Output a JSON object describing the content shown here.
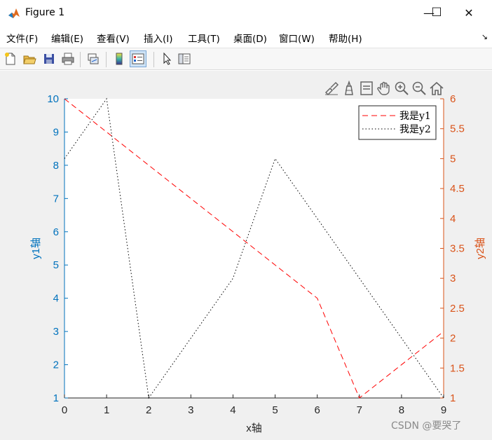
{
  "window": {
    "title": "Figure 1"
  },
  "window_controls": {
    "minimize": "—",
    "maximize": "☐",
    "close": "✕"
  },
  "menu": {
    "items": [
      "文件(F)",
      "编辑(E)",
      "查看(V)",
      "插入(I)",
      "工具(T)",
      "桌面(D)",
      "窗口(W)",
      "帮助(H)"
    ],
    "overflow_arrow": "↘"
  },
  "toolbar": {
    "icons": [
      "new-figure-icon",
      "open-file-icon",
      "save-icon",
      "print-icon",
      "link-plot-icon",
      "colorbar-icon",
      "legend-icon",
      "pointer-icon",
      "property-editor-icon"
    ]
  },
  "axes_toolbar": {
    "icons": [
      "brush-icon",
      "data-tips-icon",
      "legend-toggle-icon",
      "pan-icon",
      "zoom-in-icon",
      "zoom-out-icon",
      "home-icon"
    ]
  },
  "watermark": "CSDN @要哭了",
  "colors": {
    "y1_axis": "#0072BD",
    "y2_axis": "#D95319",
    "y1_line": "#ff0000",
    "y2_line": "#000000"
  },
  "chart_data": {
    "type": "line",
    "xlabel": "x轴",
    "ylabel_left": "y1轴",
    "ylabel_right": "y2轴",
    "xlim": [
      0,
      9
    ],
    "ylim_left": [
      1,
      10
    ],
    "ylim_right": [
      1,
      6
    ],
    "x_ticks": [
      "0",
      "1",
      "2",
      "3",
      "4",
      "5",
      "6",
      "7",
      "8",
      "9"
    ],
    "y_left_ticks": [
      "1",
      "2",
      "3",
      "4",
      "5",
      "6",
      "7",
      "8",
      "9",
      "10"
    ],
    "y_right_ticks": [
      "1",
      "1.5",
      "2",
      "2.5",
      "3",
      "3.5",
      "4",
      "4.5",
      "5",
      "5.5",
      "6"
    ],
    "series": [
      {
        "name": "我是y1",
        "axis": "left",
        "style": "dashed",
        "color": "#ff0000",
        "x": [
          0,
          1,
          2,
          3,
          4,
          5,
          6,
          7,
          8,
          9
        ],
        "values": [
          10,
          9,
          8,
          7,
          6,
          5,
          4,
          1,
          2,
          3
        ]
      },
      {
        "name": "我是y2",
        "axis": "right",
        "style": "dotted",
        "color": "#000000",
        "x": [
          0,
          1,
          2,
          3,
          4,
          5,
          6,
          7,
          8,
          9
        ],
        "values": [
          5,
          6,
          1,
          2,
          3,
          5,
          4,
          3,
          2,
          1
        ]
      }
    ],
    "legend_position": "top-right",
    "grid": false
  }
}
